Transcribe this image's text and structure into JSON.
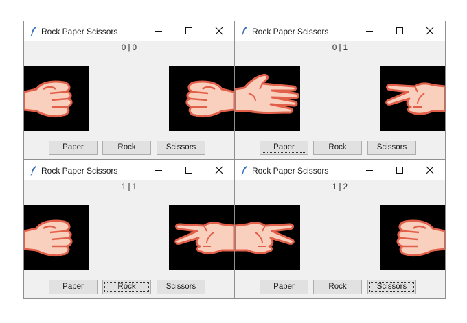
{
  "windows": [
    {
      "title": "Rock Paper Scissors",
      "score": "0 | 0",
      "left_hand": "rock-hand",
      "right_hand": "rock-hand",
      "buttons": [
        "Paper",
        "Rock",
        "Scissors"
      ],
      "focused_button": ""
    },
    {
      "title": "Rock Paper Scissors",
      "score": "0 | 1",
      "left_hand": "paper-hand",
      "right_hand": "scissors-hand",
      "buttons": [
        "Paper",
        "Rock",
        "Scissors"
      ],
      "focused_button": "Paper"
    },
    {
      "title": "Rock Paper Scissors",
      "score": "1 | 1",
      "left_hand": "rock-hand",
      "right_hand": "scissors-hand",
      "buttons": [
        "Paper",
        "Rock",
        "Scissors"
      ],
      "focused_button": "Rock"
    },
    {
      "title": "Rock Paper Scissors",
      "score": "1 | 2",
      "left_hand": "scissors-hand",
      "right_hand": "rock-hand",
      "buttons": [
        "Paper",
        "Rock",
        "Scissors"
      ],
      "focused_button": "Scissors"
    }
  ],
  "colors": {
    "skin": "#f9cfbe",
    "outline": "#e2604a",
    "hand_background": "#000000",
    "window_background": "#f0f0f0",
    "titlebar": "#ffffff",
    "icon_blue": "#3b6fb6"
  }
}
